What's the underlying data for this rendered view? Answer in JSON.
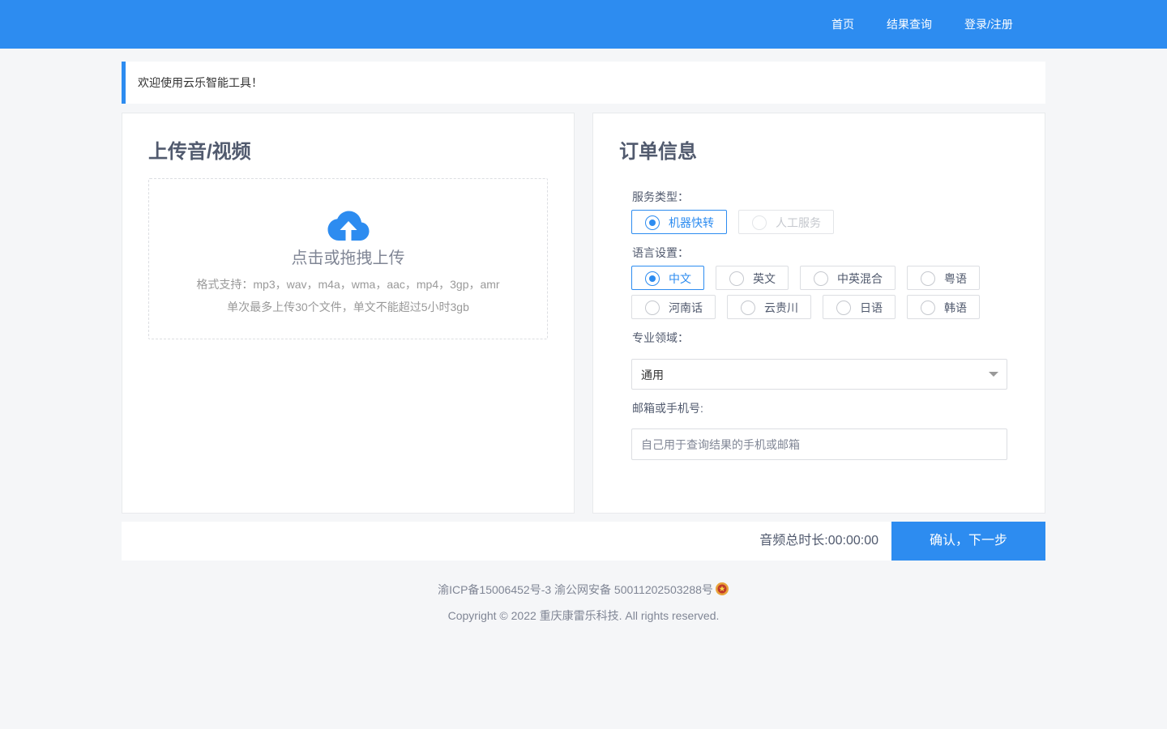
{
  "nav": {
    "home": "首页",
    "results": "结果查询",
    "login": "登录/注册"
  },
  "welcome": "欢迎使用云乐智能工具！",
  "upload": {
    "title": "上传音/视频",
    "main_text": "点击或拖拽上传",
    "formats": "格式支持：mp3，wav，m4a，wma，aac，mp4，3gp，amr",
    "limits": "单次最多上传30个文件，单文不能超过5小时3gb",
    "icon": "cloud-upload-icon"
  },
  "order": {
    "title": "订单信息",
    "service_label": "服务类型：",
    "service_options": [
      {
        "label": "机器快转",
        "checked": true,
        "disabled": false
      },
      {
        "label": "人工服务",
        "checked": false,
        "disabled": true
      }
    ],
    "language_label": "语言设置：",
    "language_options": [
      {
        "label": "中文",
        "checked": true
      },
      {
        "label": "英文",
        "checked": false
      },
      {
        "label": "中英混合",
        "checked": false
      },
      {
        "label": "粤语",
        "checked": false
      },
      {
        "label": "河南话",
        "checked": false
      },
      {
        "label": "云贵川",
        "checked": false
      },
      {
        "label": "日语",
        "checked": false
      },
      {
        "label": "韩语",
        "checked": false
      }
    ],
    "domain_label": "专业领域：",
    "domain_value": "通用",
    "contact_label": "邮箱或手机号:",
    "contact_placeholder": "自己用于查询结果的手机或邮箱",
    "contact_value": ""
  },
  "footer_bar": {
    "duration": "音频总时长:00:00:00",
    "confirm": "确认，下一步"
  },
  "footer": {
    "icp": "渝ICP备15006452号-3",
    "police": "渝公网安备 50011202503288号",
    "copyright": "Copyright © 2022 重庆康雷乐科技. All rights reserved."
  },
  "colors": {
    "primary": "#2d8cf0",
    "background": "#f5f6f8",
    "text": "#515a6e"
  }
}
